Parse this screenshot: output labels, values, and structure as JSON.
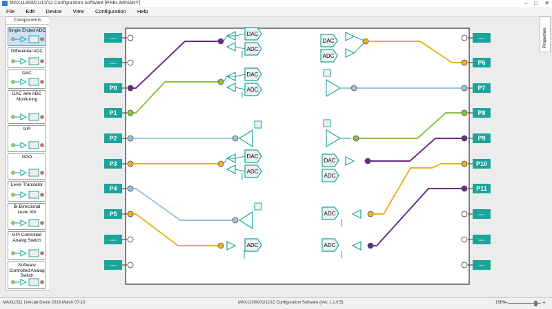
{
  "window": {
    "title": "MAX11300/01/11/12 Configuration Software [PRELIMINARY]",
    "minimize": "–",
    "maximize": "□",
    "close": "✕"
  },
  "menu": [
    "File",
    "Edit",
    "Device",
    "View",
    "Configuration",
    "Help"
  ],
  "sidebar": {
    "header": "Components",
    "items": [
      {
        "label": "Single Ended ADC",
        "selected": true
      },
      {
        "label": "Differential ADC"
      },
      {
        "label": "DAC"
      },
      {
        "label": "DAC with ADC Monitoring"
      },
      {
        "label": "GPI"
      },
      {
        "label": "GPO"
      },
      {
        "label": "Level Translator"
      },
      {
        "label": "Bi-Directional Level Xlfr"
      },
      {
        "label": "GPI Controlled Analog Switch"
      },
      {
        "label": "Software Controlled Analog Switch"
      }
    ]
  },
  "properties_tab": "Properties",
  "ports": {
    "left": [
      "----",
      "----",
      "P0",
      "P1",
      "P2",
      "P3",
      "P4",
      "P5",
      "----",
      "----"
    ],
    "right": [
      "----",
      "P6",
      "P7",
      "P8",
      "P9",
      "P10",
      "P11",
      "----",
      "----",
      "----"
    ]
  },
  "block_labels": {
    "dac": "DAC",
    "adc": "ADC"
  },
  "colors": {
    "purple": "#6a2a88",
    "green": "#8cc040",
    "blue": "#98c4dc",
    "orange": "#f0b020",
    "teal": "#1aa59a",
    "port": "#1aa59a"
  },
  "status": {
    "left": "MAX11311 LiveLab Demo 2016 March 07-10",
    "center": "MAX11300/01/11/12 Configuration Software (Ver. 1.1.0.5)",
    "zoom": "156%"
  }
}
